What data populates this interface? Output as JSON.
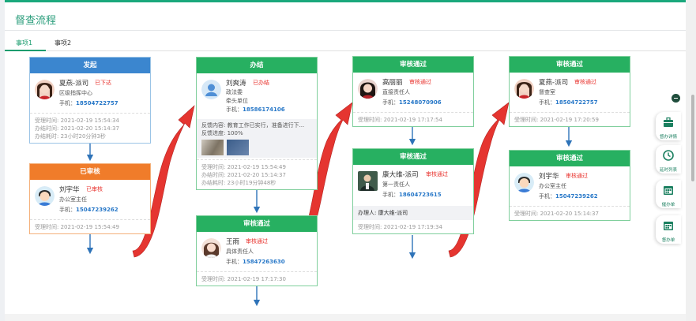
{
  "page": {
    "title": "督查流程"
  },
  "tabs": [
    {
      "label": "事项1",
      "active": true
    },
    {
      "label": "事项2",
      "active": false
    }
  ],
  "cards": {
    "c1": {
      "header": "发起",
      "name": "夏燕-派司",
      "status": "已下达",
      "role": "区级指挥中心",
      "phone_label": "手机：",
      "phone": "18504722757",
      "meta": [
        "受理时间: 2021-02-19 15:54:34",
        "办结时间: 2021-02-20 15:14:37",
        "办结耗时: 23小时20分钟3秒"
      ]
    },
    "c2": {
      "header": "已审核",
      "name": "刘宇华",
      "status": "已审核",
      "role": "办公室主任",
      "phone_label": "手机：",
      "phone": "15047239262",
      "meta": [
        "受理时间: 2021-02-19 15:54:49"
      ]
    },
    "c3": {
      "header": "办结",
      "name": "刘爽涛",
      "status": "已办结",
      "role": "政法委",
      "role2": "牵头单位",
      "phone_label": "手机：",
      "phone": "18586174106",
      "feedback_content": "反馈内容: 教育工作已实行，准备进行下...",
      "feedback_progress": "反馈进度: 100%",
      "meta": [
        "受理时间: 2021-02-19 15:54:49",
        "办结时间: 2021-02-20 15:14:37",
        "办结耗时: 23小时19分钟48秒"
      ]
    },
    "c4": {
      "header": "审核通过",
      "name": "王雨",
      "status": "审核通过",
      "role": "具体责任人",
      "phone_label": "手机：",
      "phone": "15847263630",
      "meta": [
        "受理时间: 2021-02-19 17:17:30"
      ]
    },
    "c5": {
      "header": "审核通过",
      "name": "高丽丽",
      "status": "审核通过",
      "role": "直接责任人",
      "phone_label": "手机：",
      "phone": "15248070906",
      "meta": [
        "受理时间: 2021-02-19 17:17:54"
      ]
    },
    "c6": {
      "header": "审核通过",
      "name": "康大维-派司",
      "status": "审核通过",
      "role": "第一责任人",
      "phone_label": "手机：",
      "phone": "18604723615",
      "handler": "办理人: 康大维-派司",
      "meta": [
        "受理时间: 2021-02-19 17:19:34"
      ]
    },
    "c7": {
      "header": "审核通过",
      "name": "夏燕-派司",
      "status": "审核通过",
      "role": "督查室",
      "phone_label": "手机：",
      "phone": "18504722757",
      "meta": [
        "受理时间: 2021-02-19 17:20:59"
      ]
    },
    "c8": {
      "header": "审核通过",
      "name": "刘宇华",
      "status": "审核通过",
      "role": "办公室主任",
      "phone_label": "手机：",
      "phone": "15047239262",
      "meta": [
        "受理时间: 2021-02-20 15:14:37"
      ]
    }
  },
  "sidebar": [
    {
      "label": "督办详情",
      "icon": "briefcase-icon"
    },
    {
      "label": "延时列表",
      "icon": "clock-icon"
    },
    {
      "label": "催办单",
      "icon": "calendar-icon"
    },
    {
      "label": "督办单",
      "icon": "calendar-icon"
    }
  ],
  "colors": {
    "accent": "#1a9c6e",
    "blue_header": "#3b86cf",
    "green_header": "#27b061",
    "orange_header": "#f07c2a",
    "status_red": "#e8322d",
    "phone_blue": "#2878c8",
    "flow_arrow": "#e53530"
  }
}
